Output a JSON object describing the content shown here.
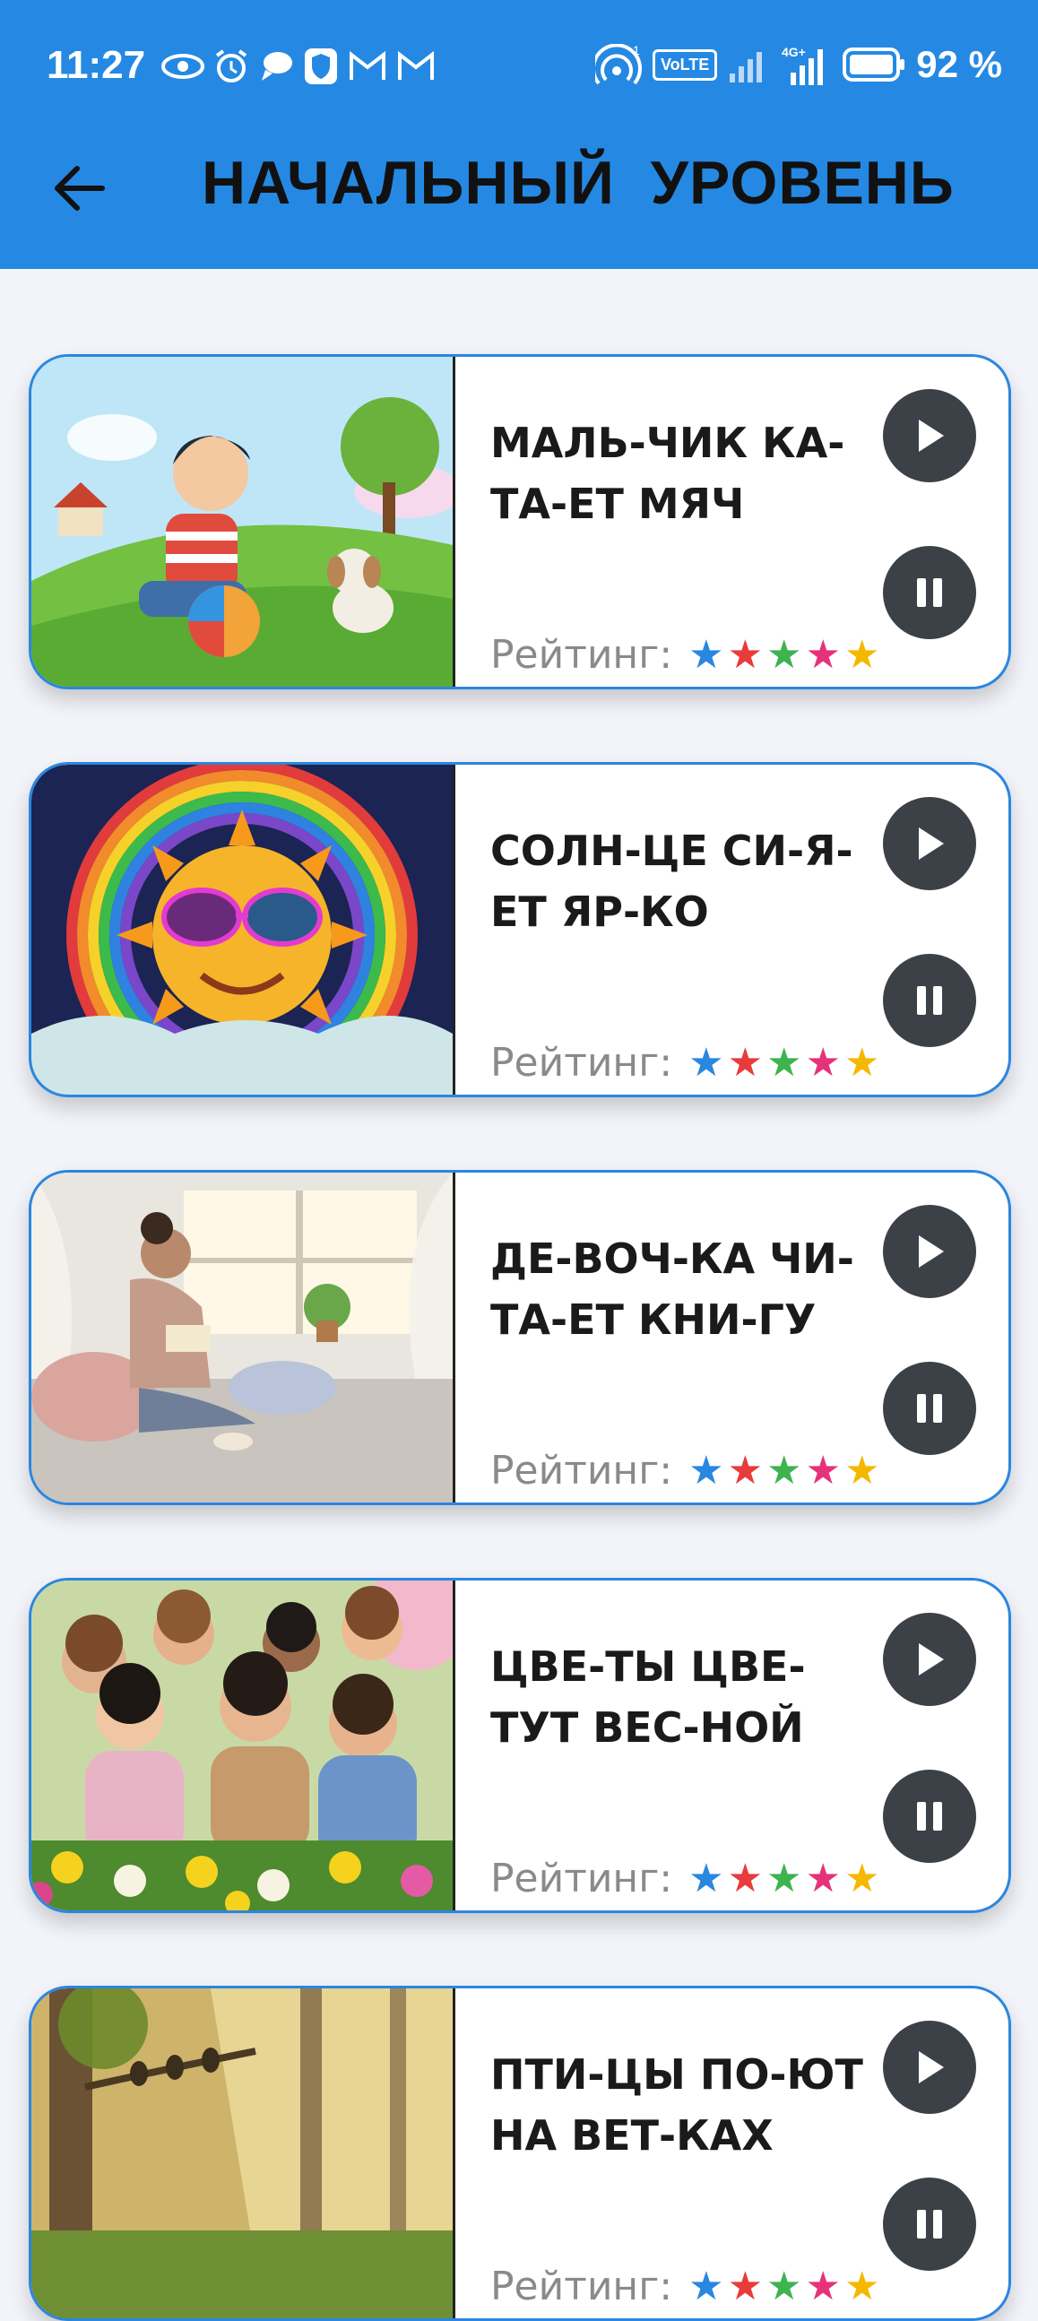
{
  "status_bar": {
    "time": "11:27",
    "battery_percent": "92 %",
    "volte_label": "VoLTE"
  },
  "app_bar": {
    "back_icon": "arrow-left-icon",
    "title": "НАЧАЛЬНЫЙ  УРОВЕНЬ"
  },
  "colors": {
    "accent": "#2589e3",
    "button": "#3c4047",
    "star_colors": [
      "#2a87e0",
      "#e83b3b",
      "#3fb34f",
      "#e6327a",
      "#f5b800"
    ]
  },
  "rating_label": "Рейтинг:",
  "cards": [
    {
      "title": "МАЛЬ-ЧИК КА-ТА-ЕТ МЯЧ",
      "image": "boy-with-ball-and-puppy",
      "stars": 5
    },
    {
      "title": "СОЛН-ЦЕ СИ-Я-ЕТ ЯР-КО",
      "image": "sun-with-sunglasses-rainbow",
      "stars": 5
    },
    {
      "title": "ДЕ-ВОЧ-КА ЧИ-ТА-ЕТ КНИ-ГУ",
      "image": "girl-reading-by-window",
      "stars": 5
    },
    {
      "title": "ЦВЕ-ТЫ ЦВЕ-ТУТ ВЕС-НОЙ",
      "image": "children-among-spring-flowers",
      "stars": 5
    },
    {
      "title": "ПТИ-ЦЫ ПО-ЮТ НА ВЕТ-КАХ",
      "image": "birds-on-branch-forest",
      "stars": 5
    }
  ]
}
